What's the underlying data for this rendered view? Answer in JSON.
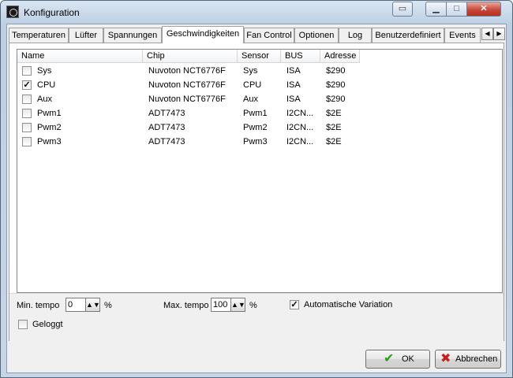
{
  "window": {
    "title": "Konfiguration"
  },
  "tabs": [
    {
      "label": "Temperaturen"
    },
    {
      "label": "Lüfter"
    },
    {
      "label": "Spannungen"
    },
    {
      "label": "Geschwindigkeiten",
      "active": true
    },
    {
      "label": "Fan Control"
    },
    {
      "label": "Optionen"
    },
    {
      "label": "Log"
    },
    {
      "label": "Benutzerdefiniert"
    },
    {
      "label": "Events"
    }
  ],
  "list": {
    "columns": [
      "Name",
      "Chip",
      "Sensor",
      "BUS",
      "Adresse"
    ],
    "rows": [
      {
        "checked": false,
        "name": "Sys",
        "chip": "Nuvoton NCT6776F",
        "sensor": "Sys",
        "bus": "ISA",
        "address": "$290"
      },
      {
        "checked": true,
        "name": "CPU",
        "chip": "Nuvoton NCT6776F",
        "sensor": "CPU",
        "bus": "ISA",
        "address": "$290"
      },
      {
        "checked": false,
        "name": "Aux",
        "chip": "Nuvoton NCT6776F",
        "sensor": "Aux",
        "bus": "ISA",
        "address": "$290"
      },
      {
        "checked": false,
        "name": "Pwm1",
        "chip": "ADT7473",
        "sensor": "Pwm1",
        "bus": "I2CN...",
        "address": "$2E"
      },
      {
        "checked": false,
        "name": "Pwm2",
        "chip": "ADT7473",
        "sensor": "Pwm2",
        "bus": "I2CN...",
        "address": "$2E"
      },
      {
        "checked": false,
        "name": "Pwm3",
        "chip": "ADT7473",
        "sensor": "Pwm3",
        "bus": "I2CN...",
        "address": "$2E"
      }
    ]
  },
  "options": {
    "min_tempo_label": "Min. tempo",
    "min_tempo_value": "0",
    "min_tempo_unit": "%",
    "max_tempo_label": "Max. tempo",
    "max_tempo_value": "100",
    "max_tempo_unit": "%",
    "auto_variation_label": "Automatische Variation",
    "auto_variation_checked": true,
    "logged_label": "Geloggt",
    "logged_checked": false
  },
  "buttons": {
    "ok": "OK",
    "cancel": "Abbrechen"
  },
  "colors": {
    "ok_icon": "#2f9b1f",
    "cancel_icon": "#c81e1e",
    "close_button": "#c9473a"
  }
}
